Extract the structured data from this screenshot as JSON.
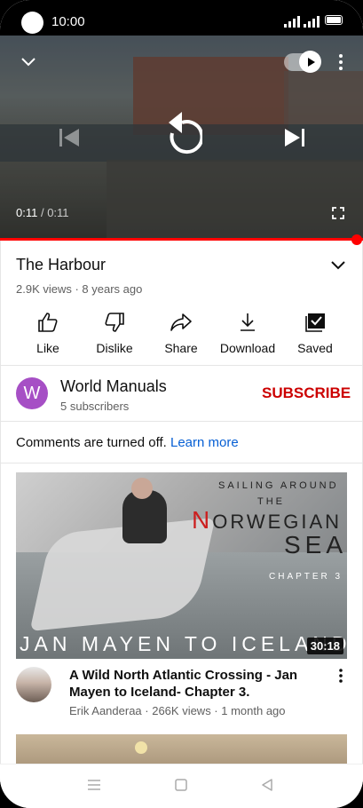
{
  "status_bar": {
    "time": "10:00"
  },
  "player": {
    "elapsed": "0:11",
    "separator": " / ",
    "duration": "0:11",
    "progress_fraction": 1.0,
    "autoplay_on": true,
    "icons": [
      "chevron-down-icon",
      "autoplay-toggle",
      "more-vert-icon",
      "skip-previous-icon",
      "replay-icon",
      "skip-next-icon",
      "fullscreen-icon"
    ]
  },
  "video": {
    "title": "The Harbour",
    "meta": "2.9K views · 8 years ago"
  },
  "actions": [
    {
      "label": "Like",
      "icon": "thumb-up-icon"
    },
    {
      "label": "Dislike",
      "icon": "thumb-down-icon"
    },
    {
      "label": "Share",
      "icon": "share-icon"
    },
    {
      "label": "Download",
      "icon": "download-icon"
    },
    {
      "label": "Saved",
      "icon": "saved-icon"
    }
  ],
  "channel": {
    "avatar_letter": "W",
    "avatar_color": "#a64fc5",
    "name": "World Manuals",
    "subscribers": "5 subscribers",
    "subscribe_label": "SUBSCRIBE"
  },
  "comments": {
    "text": "Comments are turned off.",
    "link": "Learn more"
  },
  "recommended": [
    {
      "thumbnail_text": {
        "line1": "SAILING AROUND",
        "line2": "THE",
        "line3_initial": "N",
        "line3_rest": "ORWEGIAN",
        "line4": "SEA",
        "line5": "CHAPTER 3",
        "line6": "JAN MAYEN TO ICELAND"
      },
      "duration": "30:18",
      "title": "A Wild North Atlantic Crossing - Jan Mayen to Iceland- Chapter 3.",
      "meta": "Erik Aanderaa · 266K views · 1 month ago"
    }
  ],
  "colors": {
    "accent": "#ff0000",
    "subscribe": "#cc0000",
    "link": "#065fd4"
  }
}
